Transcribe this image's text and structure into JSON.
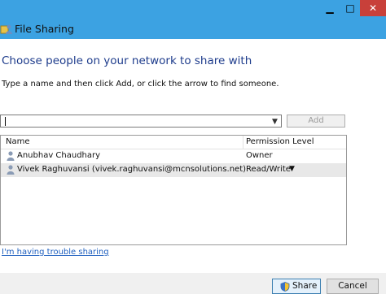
{
  "window": {
    "title": "File Sharing",
    "minimize_glyph": "▁",
    "maximize_glyph": "□",
    "close_glyph": "✕"
  },
  "heading": "Choose people on your network to share with",
  "instruction": "Type a name and then click Add, or click the arrow to find someone.",
  "name_input": {
    "value": "",
    "placeholder": ""
  },
  "add_button": "Add",
  "table": {
    "headers": [
      "Name",
      "Permission Level"
    ],
    "rows": [
      {
        "name": "Anubhav Chaudhary",
        "permission": "Owner"
      },
      {
        "name": "Vivek Raghuvansi (vivek.raghuvansi@mcnsolutions.net)",
        "permission": "Read/Write"
      }
    ]
  },
  "trouble_link": "I'm having trouble sharing",
  "footer": {
    "share_label": "Share",
    "cancel_label": "Cancel"
  },
  "colors": {
    "titlebar": "#3ca2e2",
    "heading": "#1e3c8c",
    "link": "#1e5fbf",
    "close": "#c8403a"
  },
  "icons": [
    "file-sharing-icon",
    "user-icon",
    "shield-icon",
    "chevron-down-icon"
  ]
}
